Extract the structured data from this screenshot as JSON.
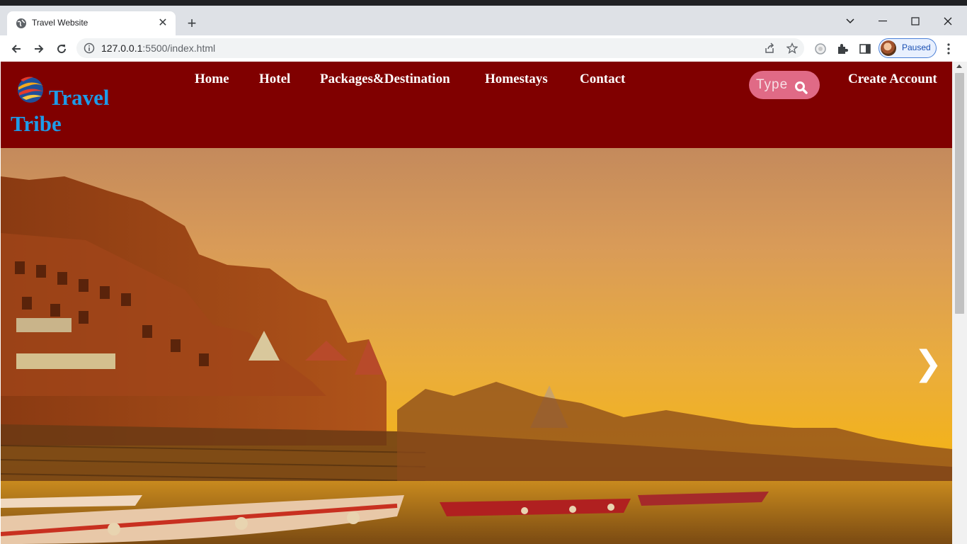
{
  "browser": {
    "tab": {
      "title": "Travel Website"
    },
    "address": {
      "host": "127.0.0.1",
      "rest": ":5500/index.html"
    },
    "profile": {
      "status": "Paused"
    }
  },
  "site": {
    "logo_text": "Travel Tribe",
    "nav": [
      "Home",
      "Hotel",
      "Packages&Destination",
      "Homestays",
      "Contact"
    ],
    "search_placeholder": "Type",
    "create_account": "Create Account",
    "hero": {
      "next_icon": "chevron-right-icon",
      "next_glyph": "❯"
    },
    "colors": {
      "header_bg": "#800000",
      "logo_text": "#1e9be8",
      "search_bg": "#e06a86",
      "nav_text": "#ffffff"
    }
  }
}
